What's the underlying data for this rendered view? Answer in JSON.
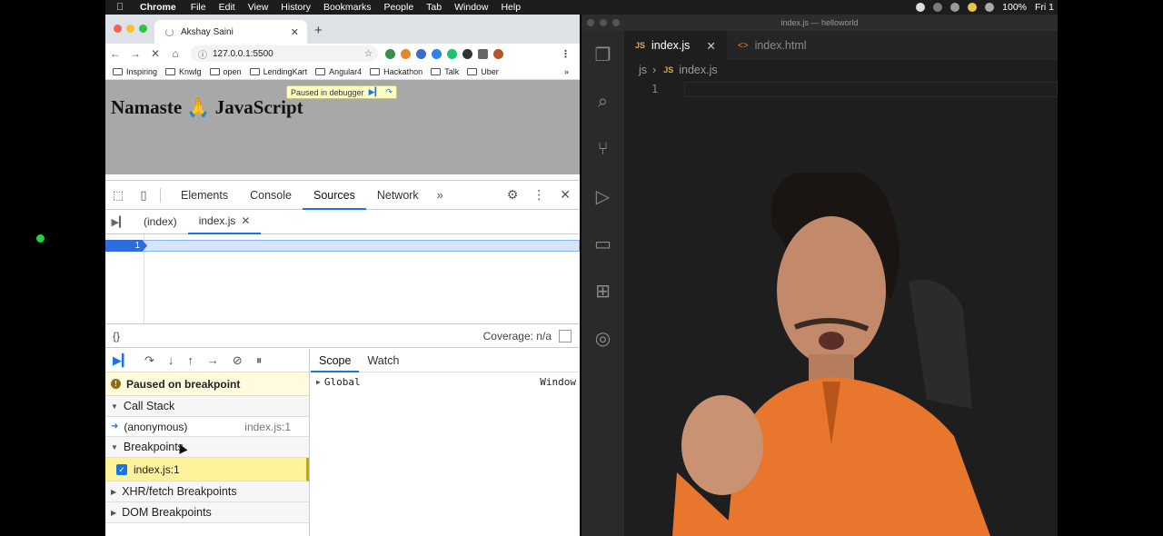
{
  "menubar": {
    "app": "Chrome",
    "items": [
      "File",
      "Edit",
      "View",
      "History",
      "Bookmarks",
      "People",
      "Tab",
      "Window",
      "Help"
    ],
    "battery": "100%",
    "clock": "Fri 1"
  },
  "chrome": {
    "tab_title": "Akshay Saini",
    "url": "127.0.0.1:5500",
    "bookmarks": [
      "Inspiring",
      "Knwlg",
      "open",
      "LendingKart",
      "Angular4",
      "Hackathon",
      "Talk",
      "Uber"
    ],
    "page_heading": "Namaste 🙏 JavaScript",
    "paused_banner": "Paused in debugger"
  },
  "devtools": {
    "tabs": [
      "Elements",
      "Console",
      "Sources",
      "Network"
    ],
    "file_tabs": [
      "(index)",
      "index.js"
    ],
    "line_number": "1",
    "format_icon": "{}",
    "coverage": "Coverage: n/a",
    "paused_message": "Paused on breakpoint",
    "call_stack_header": "Call Stack",
    "frame_name": "(anonymous)",
    "frame_location": "index.js:1",
    "breakpoints_header": "Breakpoints",
    "breakpoint_item": "index.js:1",
    "xhr_header": "XHR/fetch Breakpoints",
    "dom_header": "DOM Breakpoints",
    "scope_tabs": [
      "Scope",
      "Watch"
    ],
    "scope_name": "Global",
    "scope_value": "Window"
  },
  "vscode": {
    "title": "index.js — helloworld",
    "tabs": [
      "index.js",
      "index.html"
    ],
    "breadcrumb_folder": "js",
    "breadcrumb_file": "index.js",
    "line_number": "1"
  }
}
